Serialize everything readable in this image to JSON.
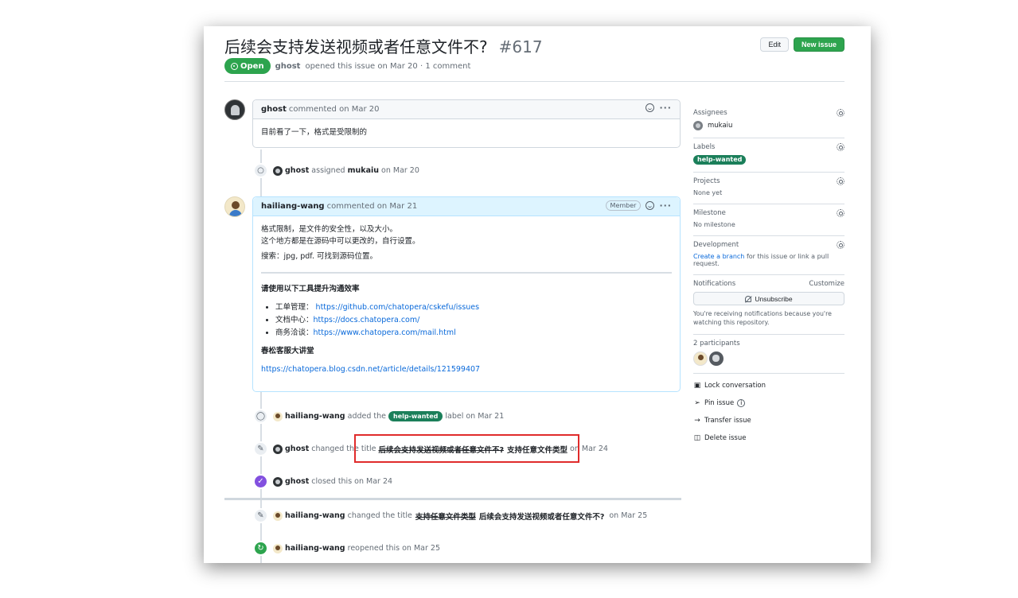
{
  "issue": {
    "title": "后续会支持发送视频或者任意文件不?",
    "number": "#617",
    "state": "Open",
    "author": "ghost",
    "meta_text": "opened this issue on Mar 20 · 1 comment"
  },
  "header_buttons": {
    "edit": "Edit",
    "new_issue": "New issue"
  },
  "comments": [
    {
      "author": "ghost",
      "when": "commented on Mar 20",
      "body": "目前看了一下，格式是受限制的"
    },
    {
      "author": "hailiang-wang",
      "when": "commented on Mar 21",
      "role": "Member",
      "lines": [
        "格式限制，是文件的安全性，以及大小。",
        "这个地方都是在源码中可以更改的，自行设置。"
      ],
      "search": "搜索：jpg, pdf. 可找到源码位置。",
      "tools_heading": "请使用以下工具提升沟通效率",
      "tools": [
        {
          "label": "工单管理：",
          "url": "https://github.com/chatopera/cskefu/issues"
        },
        {
          "label": "文档中心：",
          "url": "https://docs.chatopera.com/"
        },
        {
          "label": "商务洽谈：",
          "url": "https://www.chatopera.com/mail.html"
        }
      ],
      "lecture_heading": "春松客服大讲堂",
      "lecture_url": "https://chatopera.blog.csdn.net/article/details/121599407"
    }
  ],
  "events": {
    "assign": {
      "actor": "ghost",
      "verb": "assigned",
      "target": "mukaiu",
      "when": "on Mar 20"
    },
    "label": {
      "actor": "hailiang-wang",
      "verb": "added the",
      "label": "help-wanted",
      "tail": "label on Mar 21"
    },
    "rename1": {
      "actor": "ghost",
      "verb": "changed the title",
      "old": "后续会支持发送视频或者任意文件不?",
      "new": "支持任意文件类型",
      "when": "on Mar 24"
    },
    "closed": {
      "actor": "ghost",
      "verb": "closed this on Mar 24"
    },
    "rename2": {
      "actor": "hailiang-wang",
      "verb": "changed the title",
      "old": "支持任意文件类型",
      "new": "后续会支持发送视频或者任意文件不?",
      "when": "on Mar 25"
    },
    "reopened": {
      "actor": "hailiang-wang",
      "verb": "reopened this on Mar 25"
    }
  },
  "sidebar": {
    "assignees": {
      "heading": "Assignees",
      "user": "mukaiu"
    },
    "labels": {
      "heading": "Labels",
      "label": "help-wanted"
    },
    "projects": {
      "heading": "Projects",
      "value": "None yet"
    },
    "milestone": {
      "heading": "Milestone",
      "value": "No milestone"
    },
    "development": {
      "heading": "Development",
      "link": "Create a branch",
      "rest": "for this issue or link a pull request."
    },
    "notifications": {
      "heading": "Notifications",
      "customize": "Customize",
      "button": "Unsubscribe",
      "note": "You're receiving notifications because you're watching this repository."
    },
    "participants": {
      "heading": "2 participants"
    },
    "actions": [
      "Lock conversation",
      "Pin issue",
      "Transfer issue",
      "Delete issue"
    ]
  },
  "colors": {
    "open_green": "#2da44e",
    "closed_purple": "#8250df",
    "label_green": "#1b7f5a",
    "highlight_red": "#e02b2b",
    "link_blue": "#0969da"
  }
}
